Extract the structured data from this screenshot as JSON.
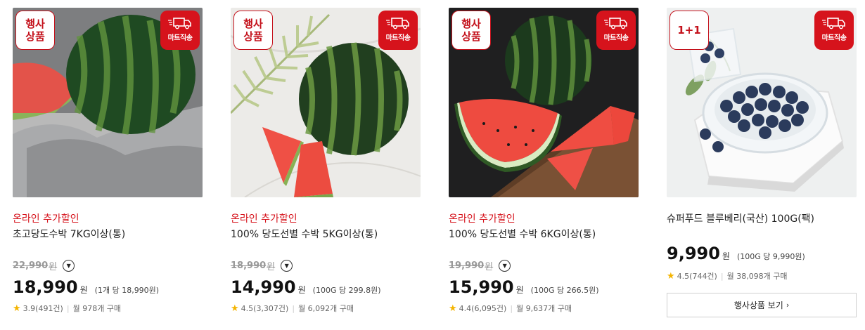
{
  "colors": {
    "accent": "#d6131c",
    "star": "#f4b400"
  },
  "icons": {
    "delivery": "truck-icon",
    "dropdown": "chevron-down-icon",
    "rating": "star-icon"
  },
  "products": [
    {
      "event_badge": "행사\n상품",
      "delivery_badge": "마트직송",
      "promo": "온라인 추가할인",
      "name": "초고당도수박 7KG이상(통)",
      "original_price": "22,990",
      "original_won": "원",
      "price": "18,990",
      "won": "원",
      "unit_price": "(1개 당 18,990원)",
      "rating": "3.9(491건)",
      "monthly": "월 978개 구매"
    },
    {
      "event_badge": "행사\n상품",
      "delivery_badge": "마트직송",
      "promo": "온라인 추가할인",
      "name": "100% 당도선별 수박 5KG이상(통)",
      "original_price": "18,990",
      "original_won": "원",
      "price": "14,990",
      "won": "원",
      "unit_price": "(100G 당 299.8원)",
      "rating": "4.5(3,307건)",
      "monthly": "월 6,092개 구매"
    },
    {
      "event_badge": "행사\n상품",
      "delivery_badge": "마트직송",
      "promo": "온라인 추가할인",
      "name": "100% 당도선별 수박 6KG이상(통)",
      "original_price": "19,990",
      "original_won": "원",
      "price": "15,990",
      "won": "원",
      "unit_price": "(100G 당 266.5원)",
      "rating": "4.4(6,095건)",
      "monthly": "월 9,637개 구매"
    },
    {
      "event_badge": "1+1",
      "delivery_badge": "마트직송",
      "name": "슈퍼푸드 블루베리(국산) 100G(팩)",
      "price": "9,990",
      "won": "원",
      "unit_price": "(100G 당 9,990원)",
      "rating": "4.5(744건)",
      "monthly": "월 38,098개 구매",
      "button": "행사상품 보기"
    }
  ]
}
